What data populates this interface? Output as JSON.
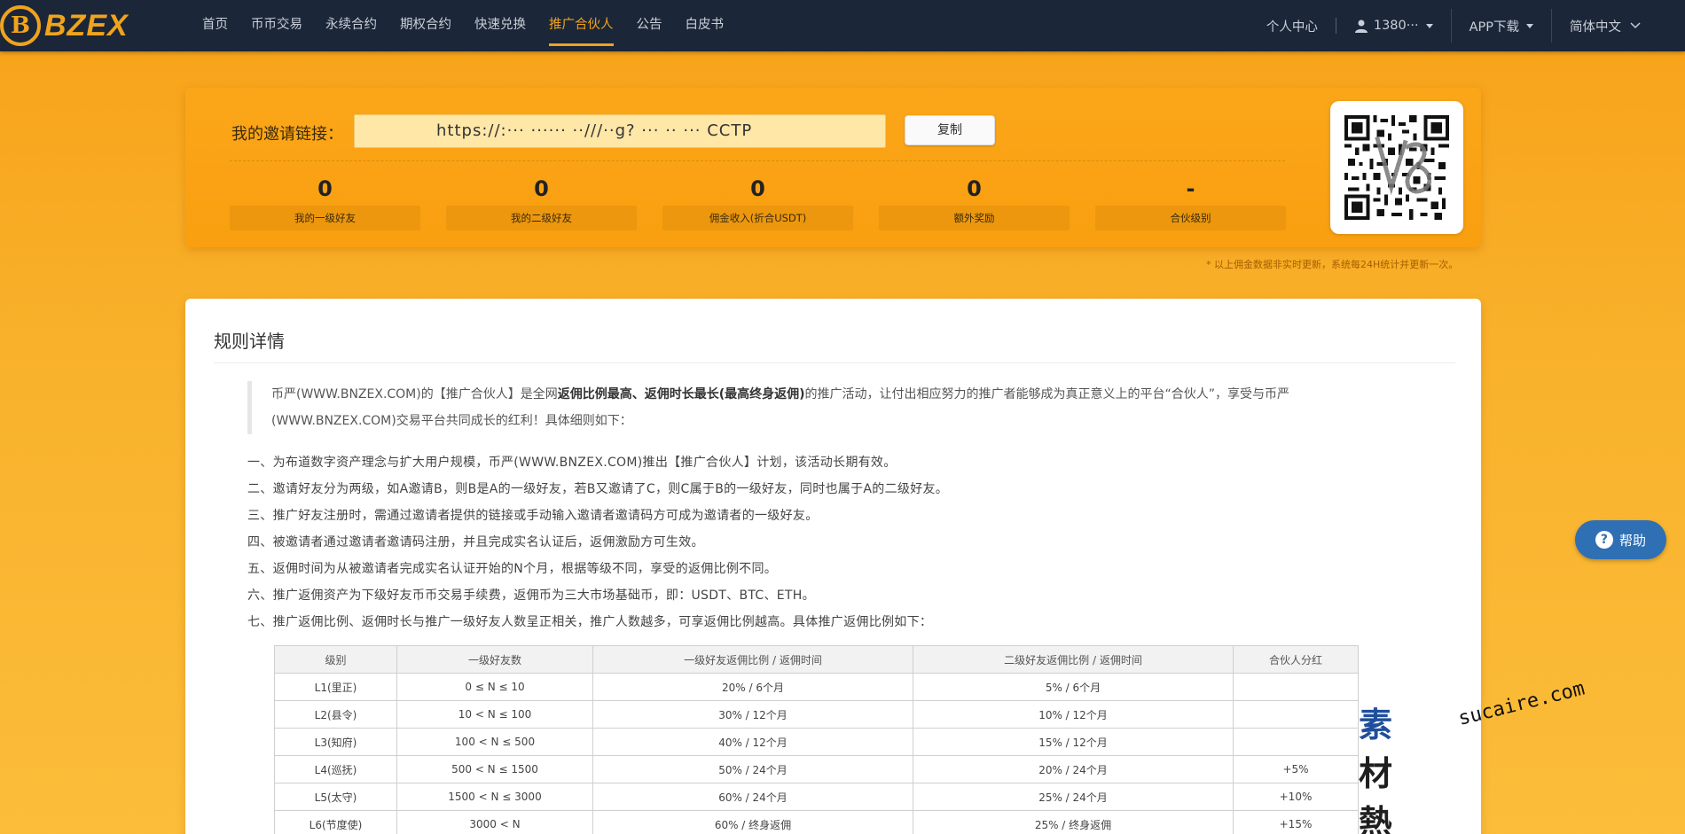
{
  "brand": {
    "coin": "B",
    "name": "BZEX"
  },
  "nav": {
    "links": [
      "首页",
      "币币交易",
      "永续合约",
      "期权合约",
      "快速兑换",
      "推广合伙人",
      "公告",
      "白皮书"
    ],
    "active_index": 5
  },
  "nav_right": {
    "personal_center": "个人中心",
    "user": "1380···",
    "app_download": "APP下载",
    "language": "简体中文"
  },
  "invite": {
    "label": "我的邀请链接：",
    "link": "https://:··· ······ ··///··g? ··· ·· ··· CCTP",
    "copy_button": "复制",
    "stats": [
      {
        "value": "0",
        "label": "我的一级好友"
      },
      {
        "value": "0",
        "label": "我的二级好友"
      },
      {
        "value": "0",
        "label": "佣金收入(折合USDT)"
      },
      {
        "value": "0",
        "label": "额外奖励"
      },
      {
        "value": "-",
        "label": "合伙级别"
      }
    ],
    "note": "* 以上佣金数据非实时更新，系统每24H统计并更新一次。"
  },
  "rules": {
    "title": "规则详情",
    "intro_parts": [
      "币严(WWW.BNZEX.COM)的【推广合伙人】是全网",
      "返佣比例最高、返佣时长最长(最高终身返佣)",
      "的推广活动，让付出相应努力的推广者能够成为真正意义上的平台“合伙人”，享受与币严(WWW.BNZEX.COM)交易平台共同成长的红利！具体细则如下："
    ],
    "items": [
      "一、为布道数字资产理念与扩大用户规模，币严(WWW.BNZEX.COM)推出【推广合伙人】计划，该活动长期有效。",
      "二、邀请好友分为两级，如A邀请B，则B是A的一级好友，若B又邀请了C，则C属于B的一级好友，同时也属于A的二级好友。",
      "三、推广好友注册时，需通过邀请者提供的链接或手动输入邀请者邀请码方可成为邀请者的一级好友。",
      "四、被邀请者通过邀请者邀请码注册，并且完成实名认证后，返佣激励方可生效。",
      "五、返佣时间为从被邀请者完成实名认证开始的N个月，根据等级不同，享受的返佣比例不同。",
      "六、推广返佣资产为下级好友币币交易手续费，返佣币为三大市场基础币，即：USDT、BTC、ETH。",
      "七、推广返佣比例、返佣时长与推广一级好友人数呈正相关，推广人数越多，可享返佣比例越高。具体推广返佣比例如下："
    ],
    "table": {
      "headers": [
        "级别",
        "一级好友数",
        "一级好友返佣比例 / 返佣时间",
        "二级好友返佣比例 / 返佣时间",
        "合伙人分红"
      ],
      "rows": [
        [
          "L1(里正)",
          "0 ≤ N ≤ 10",
          "20% / 6个月",
          "5% / 6个月",
          ""
        ],
        [
          "L2(县令)",
          "10 < N ≤ 100",
          "30% / 12个月",
          "10% / 12个月",
          ""
        ],
        [
          "L3(知府)",
          "100 < N ≤ 500",
          "40% / 12个月",
          "15% / 12个月",
          ""
        ],
        [
          "L4(巡抚)",
          "500 < N ≤ 1500",
          "50% / 24个月",
          "20% / 24个月",
          "+5%"
        ],
        [
          "L5(太守)",
          "1500 < N ≤ 3000",
          "60% / 24个月",
          "25% / 24个月",
          "+10%"
        ],
        [
          "L6(节度使)",
          "3000 < N",
          "60% / 终身返佣",
          "25% / 终身返佣",
          "+15%"
        ]
      ]
    }
  },
  "help": {
    "icon": "?",
    "label": "帮助"
  },
  "watermark": {
    "mark_blue": "素",
    "mark_dark": "材熱",
    "url": "sucaire.com"
  },
  "colors": {
    "accent": "#f0a31c",
    "nav_bg": "#1b2638",
    "help_bg": "#2f6fb4"
  }
}
